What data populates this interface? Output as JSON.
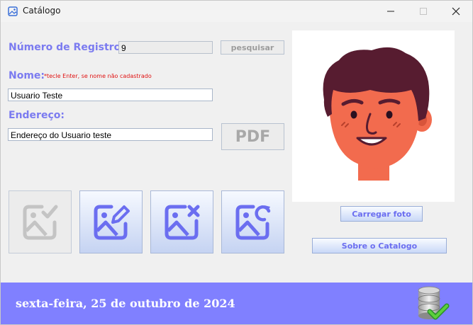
{
  "window": {
    "title": "Catálogo"
  },
  "form": {
    "registro_label": "Número de Registro:",
    "registro_value": "9",
    "pesquisar_label": "pesquisar",
    "nome_label": "Nome:",
    "nome_hint": "*tecle Enter, se nome não cadastrado",
    "nome_value": "Usuario Teste",
    "endereco_label": "Endereço:",
    "endereco_value": "Endereço do Usuario teste",
    "pdf_label": "PDF"
  },
  "photo": {
    "carregar_label": "Carregar foto",
    "sobre_label": "Sobre o Catalogo"
  },
  "icon_buttons": [
    "image-check-icon",
    "image-edit-icon",
    "image-delete-icon",
    "image-refresh-icon"
  ],
  "footer": {
    "date": "sexta-feira, 25 de outubro de 2024"
  },
  "colors": {
    "accent": "#7b7bf0",
    "footer_bg": "#8080ff",
    "hint": "#e01010",
    "icon": "#6b6ef0",
    "disabled_icon": "#c0c0c0"
  }
}
